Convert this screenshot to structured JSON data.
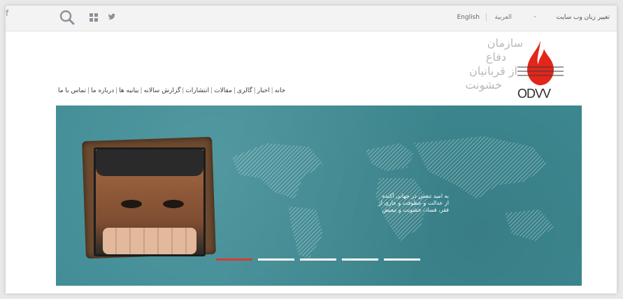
{
  "topbar": {
    "icons": [
      "search-icon",
      "grid-icon",
      "twitter-icon",
      "facebook-icon"
    ],
    "language_change_label": "تغییر زبان وب سایت",
    "language_arabic": "العربية",
    "language_english": "English"
  },
  "logo": {
    "text": "ODVV",
    "flame_color": "#e2261b"
  },
  "org_name": {
    "line1": "سازمان",
    "line2": "دفاع",
    "line3": "از قربانیان",
    "line4": "خشونت"
  },
  "nav": {
    "items": [
      "خانه",
      "اخبار",
      "گالری",
      "مقالات",
      "انتشارات",
      "گزارش سالانه",
      "بیانیه ها",
      "درباره ما",
      "تماس با ما"
    ]
  },
  "banner": {
    "caption_line1": "به امید تنفس در جهانی آکنده",
    "caption_line2": "از عدالت و عطوفت و عاری از",
    "caption_line3": "فقر، فساد، خشونت و تبعیض",
    "slides": 5,
    "active_slide": 1,
    "background_color": "#3f8c95",
    "active_dot_color": "#d93b32"
  }
}
